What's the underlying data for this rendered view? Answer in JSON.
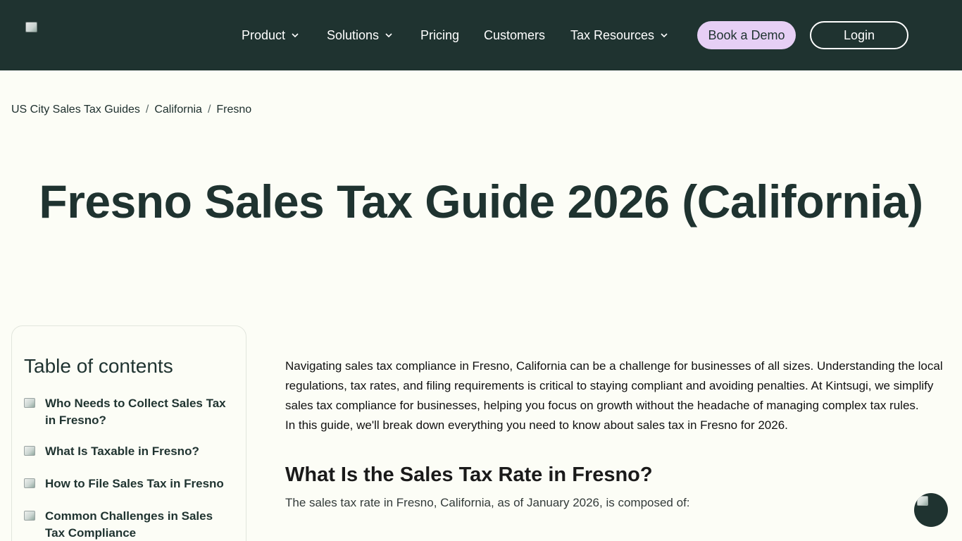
{
  "header": {
    "nav": [
      {
        "label": "Product",
        "has_dropdown": true
      },
      {
        "label": "Solutions",
        "has_dropdown": true
      },
      {
        "label": "Pricing",
        "has_dropdown": false
      },
      {
        "label": "Customers",
        "has_dropdown": false
      },
      {
        "label": "Tax Resources",
        "has_dropdown": true
      }
    ],
    "demo_label": "Book a Demo",
    "login_label": "Login"
  },
  "breadcrumb": {
    "items": [
      "US City Sales Tax Guides",
      "California",
      "Fresno"
    ],
    "separator": "/"
  },
  "page_title": "Fresno Sales Tax Guide 2026 (California)",
  "toc": {
    "title": "Table of contents",
    "items": [
      "Who Needs to Collect Sales Tax in Fresno?",
      "What Is Taxable in Fresno?",
      "How to File Sales Tax in Fresno",
      "Common Challenges in Sales Tax Compliance"
    ]
  },
  "content": {
    "intro": "Navigating sales tax compliance in Fresno, California can be a challenge for businesses of all sizes. Understanding the local regulations, tax rates, and filing requirements is critical to staying compliant and avoiding penalties. At Kintsugi, we simplify sales tax compliance for businesses, helping you focus on growth without the headache of managing complex tax rules.",
    "guide_line": "In this guide, we'll break down everything you need to know about sales tax in Fresno for 2026.",
    "section_heading": "What Is the Sales Tax Rate in Fresno?",
    "rate_intro": "The sales tax rate in Fresno, California, as of January 2026, is composed of:"
  },
  "colors": {
    "header_bg": "#1f3330",
    "page_bg": "#fcfdf6",
    "demo_button_bg": "#e6cff5",
    "text_dark": "#1f3330"
  },
  "icons": {
    "logo": "broken-image-icon",
    "dropdown": "chevron-down-icon",
    "toc_bullet": "broken-image-icon",
    "chat": "chat-support-icon"
  }
}
